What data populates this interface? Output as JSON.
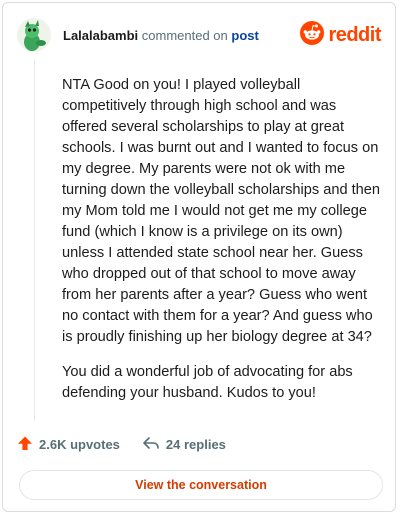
{
  "header": {
    "username": "Lalalabambi",
    "action_text": "commented on",
    "post_link": "post",
    "brand_name": "reddit"
  },
  "comment": {
    "paragraphs": [
      "NTA Good on you! I played volleyball competitively through high school and was offered several scholarships to play at great schools. I was burnt out and I wanted to focus on my degree. My parents were not ok with me turning down the volleyball scholarships and then my Mom told me I would not get me my college fund (which I know is a privilege on its own) unless I attended state school near her. Guess who dropped out of that school to move away from her parents after a year? Guess who went no contact with them for a year? And guess who is proudly finishing up her biology degree at 34?",
      "You did a wonderful job of advocating for abs defending your husband. Kudos to you!"
    ]
  },
  "actions": {
    "upvotes": "2.6K upvotes",
    "replies": "24 replies"
  },
  "cta": {
    "label": "View the conversation"
  },
  "icons": {
    "avatar": "snoo-avatar-icon",
    "brand": "reddit-logo-icon",
    "upvote": "upvote-arrow-icon",
    "reply": "reply-arrow-icon"
  },
  "colors": {
    "brand": "#ff4500",
    "link": "#0a449b",
    "cta_text": "#d93a00",
    "meta": "#576f76"
  }
}
